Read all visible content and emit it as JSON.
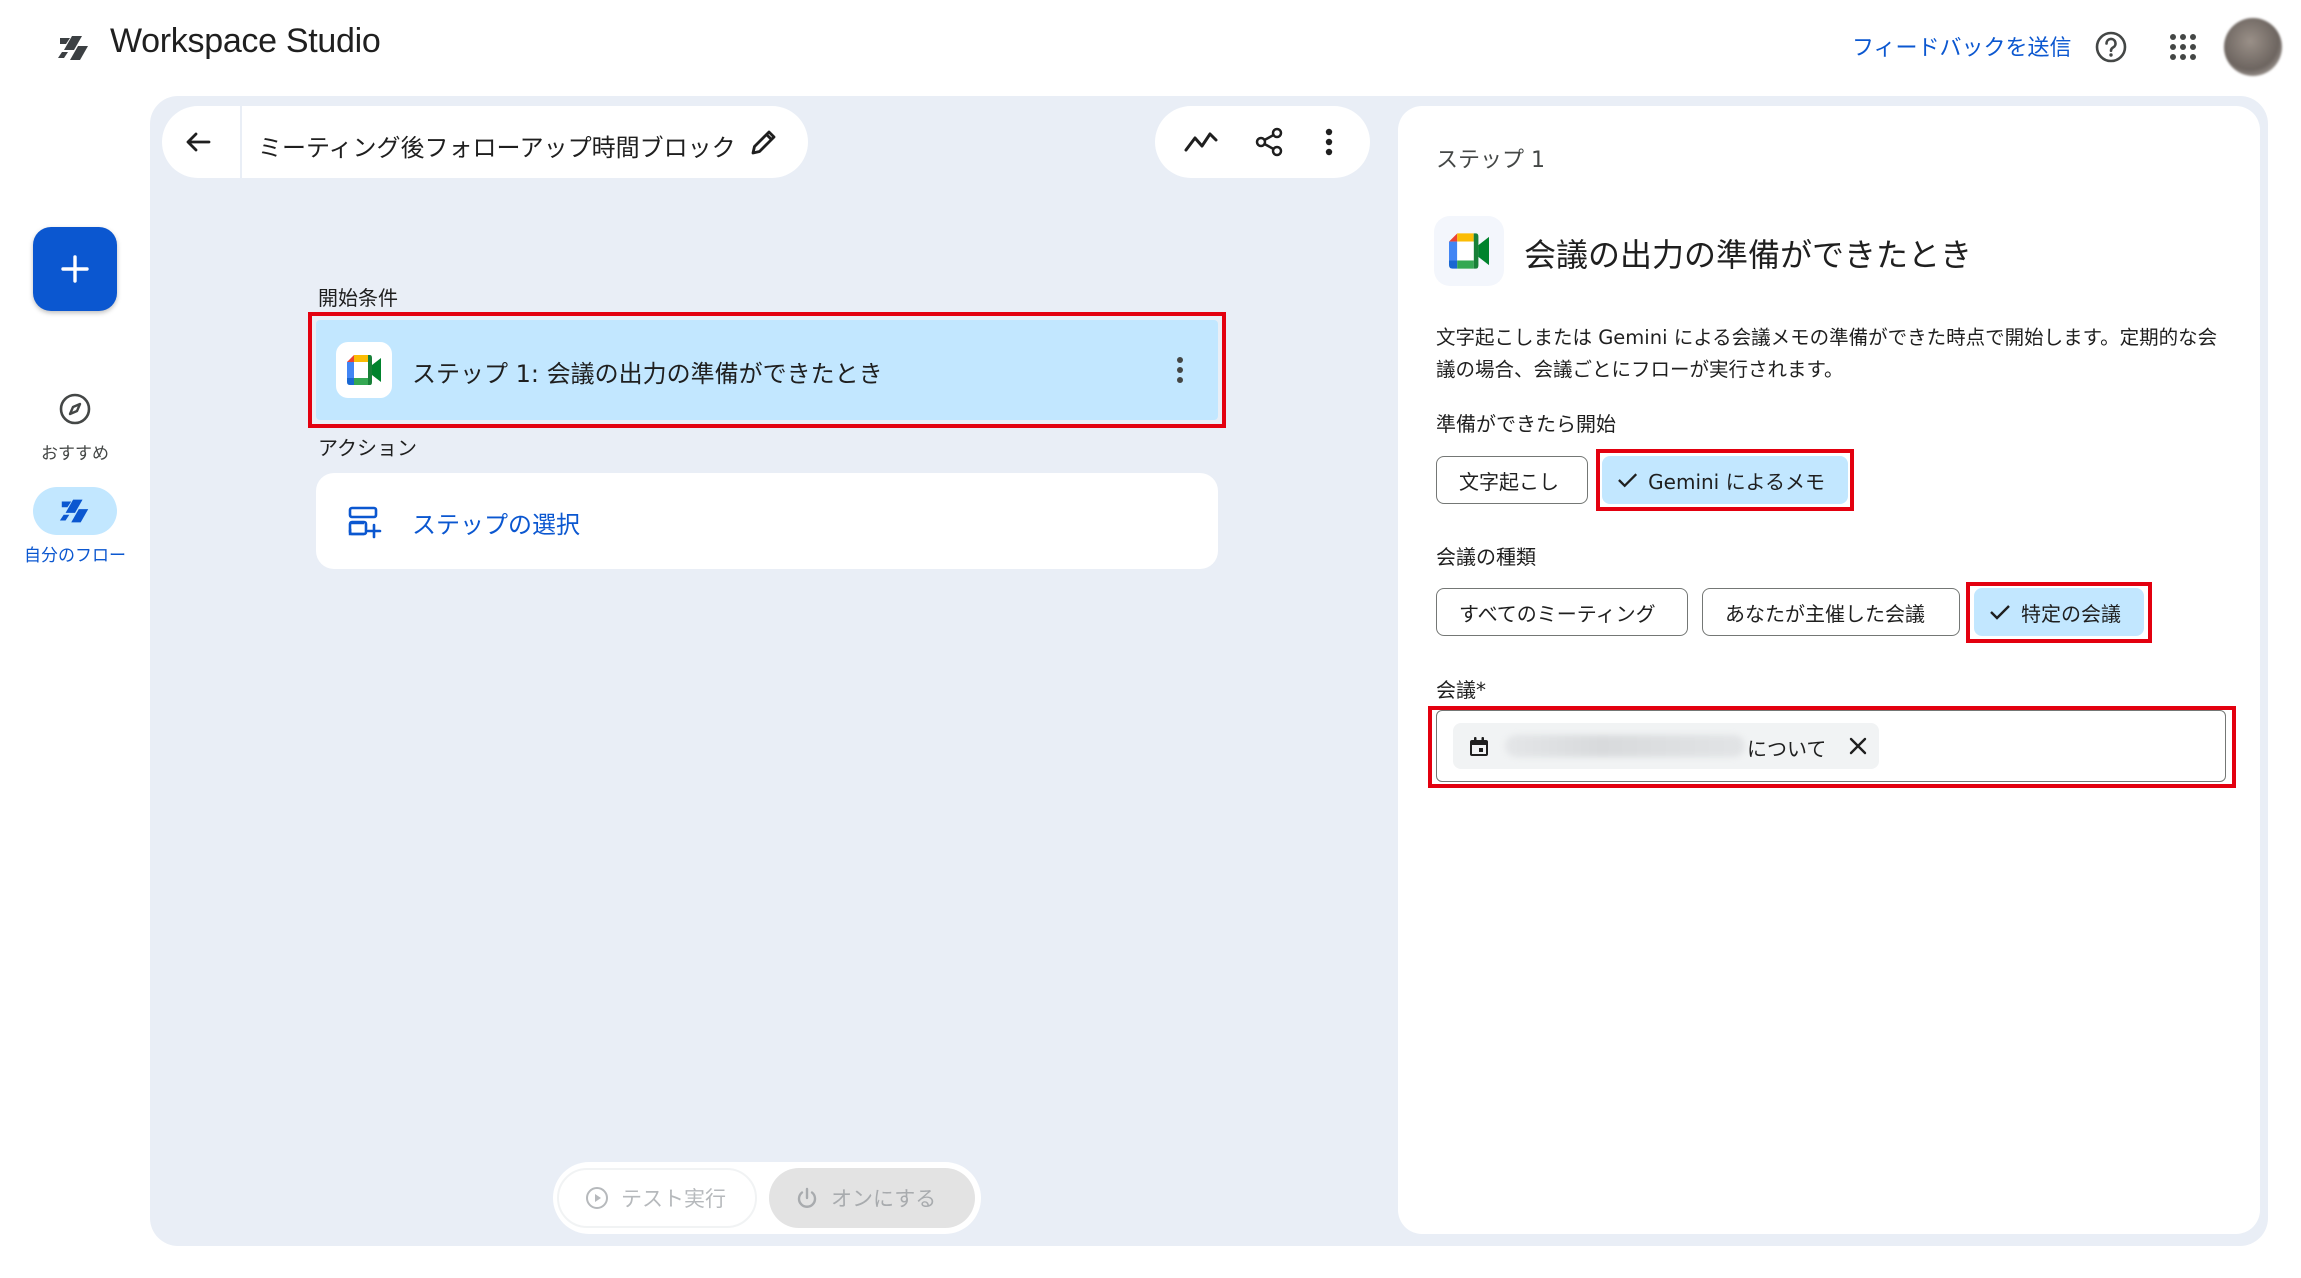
{
  "app": {
    "name": "Workspace Studio",
    "feedback_link": "フィードバックを送信",
    "icons": {
      "logo": "workspace-studio-logo-icon",
      "help": "help-circle-icon",
      "apps": "apps-grid-icon"
    },
    "colors": {
      "accent": "#0b57d0",
      "canvas": "#e9eef6",
      "selected": "#c2e7ff",
      "highlight": "#e3000f"
    }
  },
  "rail": {
    "create_icon": "plus-icon",
    "items": [
      {
        "label": "おすすめ",
        "icon": "compass-icon",
        "selected": false
      },
      {
        "label": "自分のフロー",
        "icon": "workspace-studio-logo-icon",
        "selected": true
      }
    ]
  },
  "flow": {
    "title": "ミーティング後フォローアップ時間ブロック",
    "back_icon": "arrow-back-icon",
    "edit_icon": "pencil-icon",
    "toolbar_icons": [
      "activity-icon",
      "share-icon",
      "more-vert-icon"
    ],
    "trigger_section": "開始条件",
    "trigger_step": "ステップ 1: 会議の出力の準備ができたとき",
    "action_section": "アクション",
    "action_select": "ステップの選択",
    "test_run": "テスト実行",
    "turn_on": "オンにする"
  },
  "panel": {
    "step_label": "ステップ 1",
    "title": "会議の出力の準備ができたとき",
    "description": "文字起こしまたは Gemini による会議メモの準備ができた時点で開始します。定期的な会議の場合、会議ごとにフローが実行されます。",
    "ready_label": "準備ができたら開始",
    "ready_options": [
      {
        "label": "文字起こし",
        "selected": false
      },
      {
        "label": "Gemini によるメモ",
        "selected": true
      }
    ],
    "meeting_type_label": "会議の種類",
    "meeting_type_options": [
      {
        "label": "すべてのミーティング",
        "selected": false
      },
      {
        "label": "あなたが主催した会議",
        "selected": false
      },
      {
        "label": "特定の会議",
        "selected": true
      }
    ],
    "meeting_label": "会議*",
    "meeting_chip_suffix": "について"
  }
}
